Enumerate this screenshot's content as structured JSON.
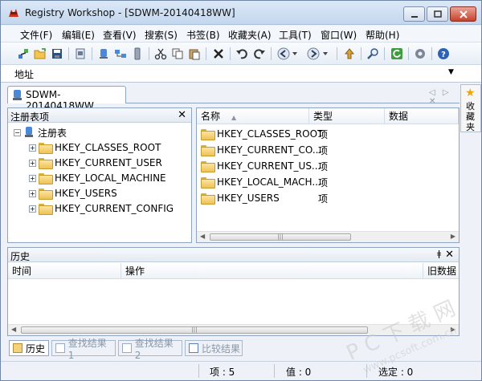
{
  "window": {
    "title": "Registry Workshop - [SDWM-20140418WW]"
  },
  "menu": [
    "文件(F)",
    "编辑(E)",
    "查看(V)",
    "搜索(S)",
    "书签(B)",
    "收藏夹(A)",
    "工具(T)",
    "窗口(W)",
    "帮助(H)"
  ],
  "toolbar": {
    "icons": [
      "connect-icon",
      "open-icon",
      "save-icon",
      "export-icon",
      "registry-icon",
      "network-icon",
      "usb-icon",
      "cut-icon",
      "copy-icon",
      "paste-icon",
      "delete-icon",
      "undo-icon",
      "redo-icon",
      "back-icon",
      "forward-icon",
      "go-up-icon",
      "find-icon",
      "refresh-icon",
      "settings-icon",
      "help-icon"
    ]
  },
  "address": {
    "label": "地址",
    "value": ""
  },
  "document_tab": {
    "label": "SDWM-20140418WW"
  },
  "favorites": {
    "label": "收藏夹"
  },
  "tree_panel": {
    "title": "注册表项",
    "root": "注册表",
    "keys": [
      "HKEY_CLASSES_ROOT",
      "HKEY_CURRENT_USER",
      "HKEY_LOCAL_MACHINE",
      "HKEY_USERS",
      "HKEY_CURRENT_CONFIG"
    ]
  },
  "list_panel": {
    "columns": [
      "名称",
      "类型",
      "数据"
    ],
    "rows": [
      {
        "name": "HKEY_CLASSES_ROOT",
        "type": "项"
      },
      {
        "name": "HKEY_CURRENT_CO...",
        "type": "项"
      },
      {
        "name": "HKEY_CURRENT_US...",
        "type": "项"
      },
      {
        "name": "HKEY_LOCAL_MACH...",
        "type": "项"
      },
      {
        "name": "HKEY_USERS",
        "type": "项"
      }
    ]
  },
  "history_panel": {
    "title": "历史",
    "columns": [
      "时间",
      "操作",
      "旧数据"
    ]
  },
  "bottom_tabs": [
    "历史",
    "查找结果 1",
    "查找结果 2",
    "比较结果"
  ],
  "status": {
    "items": "项 : 5",
    "values": "值 : 0",
    "selected": "选定 : 0"
  },
  "watermark": {
    "line1": "P C 下 载 网",
    "line2": "www.pcsoft.com.cn"
  },
  "colors": {
    "accent": "#c7412b",
    "folder": "#eec255",
    "window_bg": "#eef2f8"
  }
}
